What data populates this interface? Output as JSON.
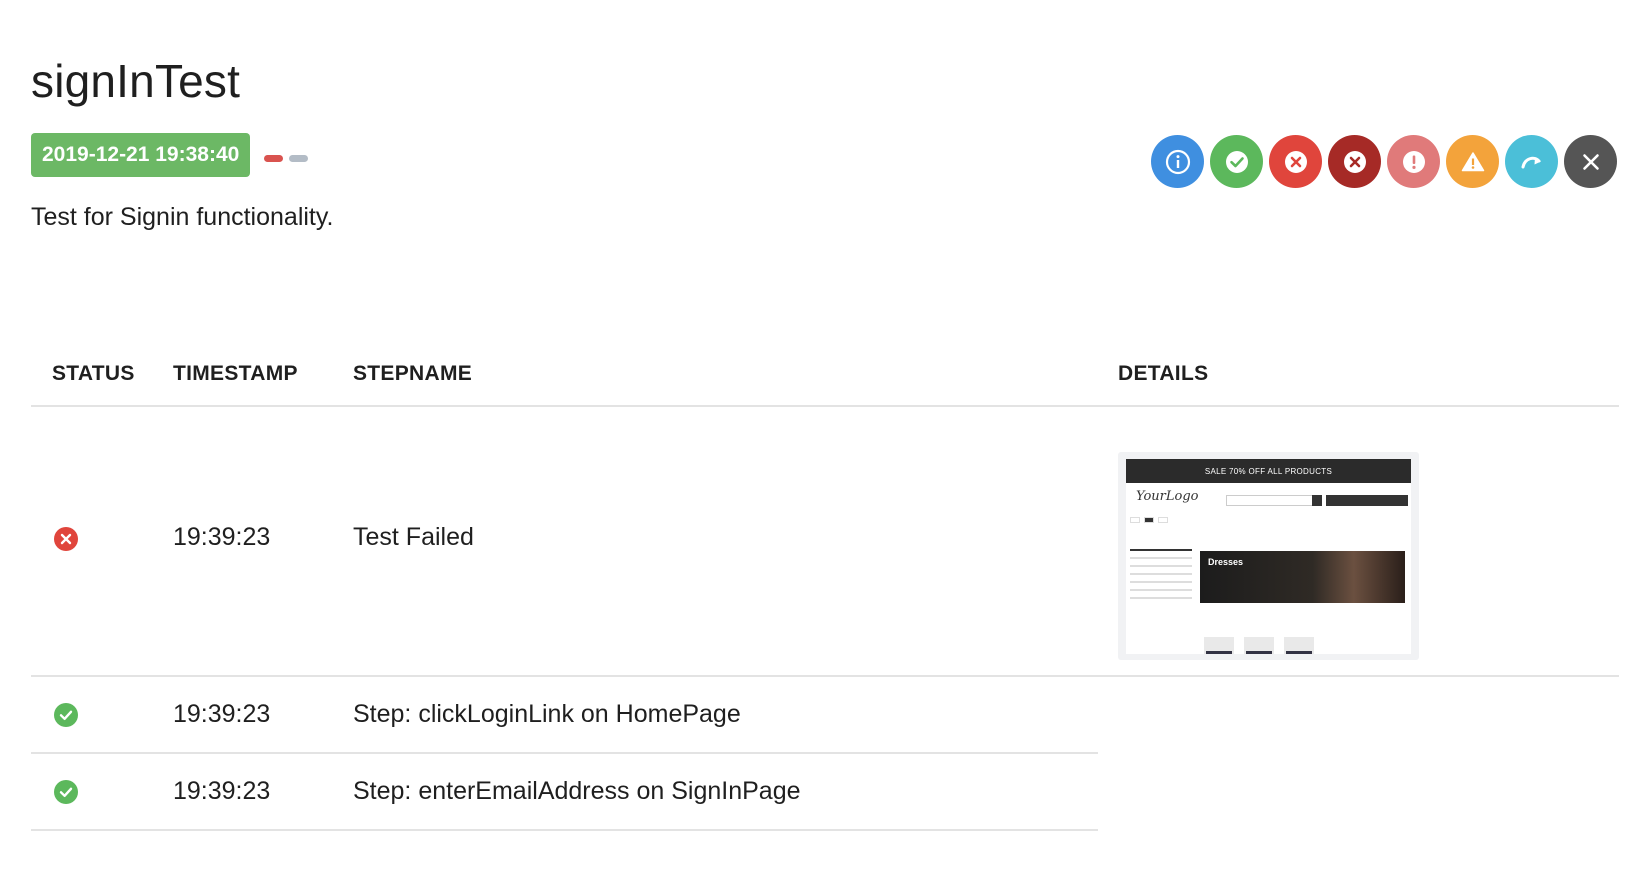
{
  "test": {
    "title": "signInTest",
    "date": "2019-12-21 19:38:40",
    "description": "Test for Signin functionality."
  },
  "filters": [
    {
      "name": "info",
      "color": "#3f8fe0",
      "icon": "info-icon"
    },
    {
      "name": "pass",
      "color": "#5cb85c",
      "icon": "check-icon"
    },
    {
      "name": "fail",
      "color": "#e0453c",
      "icon": "x-circle-icon"
    },
    {
      "name": "fatal",
      "color": "#a62a26",
      "icon": "x-circle-icon"
    },
    {
      "name": "error",
      "color": "#e07a7a",
      "icon": "exclamation-icon"
    },
    {
      "name": "warning",
      "color": "#f3a33b",
      "icon": "warning-icon"
    },
    {
      "name": "skip",
      "color": "#4bbfd8",
      "icon": "skip-arrow-icon"
    },
    {
      "name": "clear",
      "color": "#555555",
      "icon": "close-icon"
    }
  ],
  "table": {
    "headers": {
      "status": "STATUS",
      "timestamp": "TIMESTAMP",
      "stepname": "STEPNAME",
      "details": "DETAILS"
    },
    "rows": [
      {
        "status": "fail",
        "timestamp": "19:39:23",
        "step": "Test Failed"
      },
      {
        "status": "pass",
        "timestamp": "19:39:23",
        "step": "Step: clickLoginLink on HomePage"
      },
      {
        "status": "pass",
        "timestamp": "19:39:23",
        "step": "Step: enterEmailAddress on SignInPage"
      }
    ]
  },
  "screenshot": {
    "sale_text": "SALE 70% OFF ALL PRODUCTS",
    "logo_text": "YourLogo",
    "hero_title": "Dresses"
  },
  "colors": {
    "badge": "#6cb865",
    "fail": "#e0453c",
    "pass": "#5cb85c",
    "border": "#e3e3e3"
  }
}
